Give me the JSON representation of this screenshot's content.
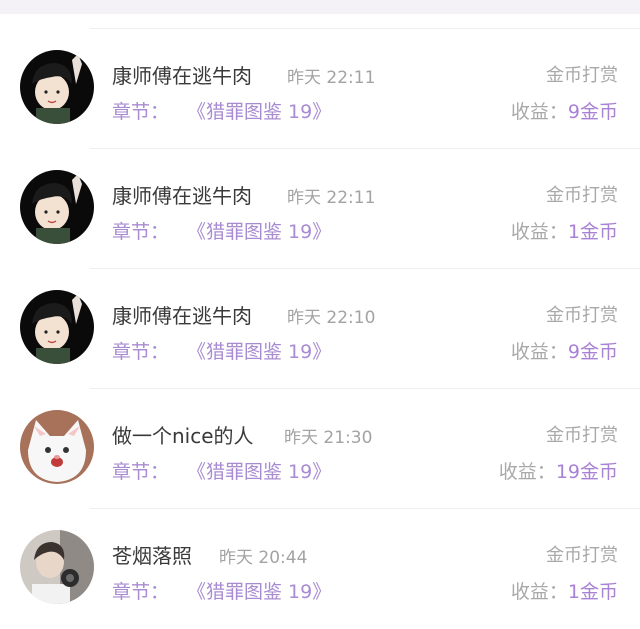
{
  "records": [
    {
      "name": "康师傅在逃牛肉",
      "time": "昨天 22:11",
      "type": "金币打赏",
      "chapter_label": "章节：",
      "chapter_title": "《猎罪图鉴 19》",
      "earn_label": "收益：",
      "earn_value": "9金币",
      "avatar": "cartoon-boy-avatar"
    },
    {
      "name": "康师傅在逃牛肉",
      "time": "昨天 22:11",
      "type": "金币打赏",
      "chapter_label": "章节：",
      "chapter_title": "《猎罪图鉴 19》",
      "earn_label": "收益：",
      "earn_value": "1金币",
      "avatar": "cartoon-boy-avatar"
    },
    {
      "name": "康师傅在逃牛肉",
      "time": "昨天 22:10",
      "type": "金币打赏",
      "chapter_label": "章节：",
      "chapter_title": "《猎罪图鉴 19》",
      "earn_label": "收益：",
      "earn_value": "9金币",
      "avatar": "cartoon-boy-avatar"
    },
    {
      "name": "做一个nice的人",
      "time": "昨天 21:30",
      "type": "金币打赏",
      "chapter_label": "章节：",
      "chapter_title": "《猎罪图鉴 19》",
      "earn_label": "收益：",
      "earn_value": "19金币",
      "avatar": "white-cat-avatar"
    },
    {
      "name": "苍烟落照",
      "time": "昨天 20:44",
      "type": "金币打赏",
      "chapter_label": "章节：",
      "chapter_title": "《猎罪图鉴 19》",
      "earn_label": "收益：",
      "earn_value": "1金币",
      "avatar": "photo-person-avatar"
    }
  ],
  "colors": {
    "accent": "#a882d6",
    "chapter": "#a88bd2",
    "muted": "#a9a9a9",
    "name": "#3a3a3a"
  }
}
